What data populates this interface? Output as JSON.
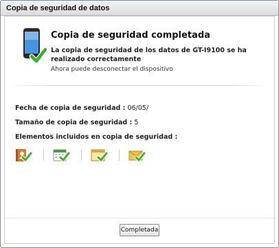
{
  "window": {
    "title": "Copia de seguridad de datos"
  },
  "header": {
    "title": "Copia de seguridad completada",
    "subtitle": "La copia de seguridad de los datos de GT-I9100 se ha realizado correctamente",
    "note": "Ahora puede desconectar el dispositivo"
  },
  "details": {
    "date_label": "Fecha de copia de seguridad :",
    "date_value": "06/05/",
    "size_label": "Tamaño de copia de seguridad :",
    "size_value": "5",
    "items_label": "Elementos incluidos en copia de seguridad :"
  },
  "items": [
    {
      "icon": "contacts-icon"
    },
    {
      "icon": "calendar-icon"
    },
    {
      "icon": "window-icon"
    },
    {
      "icon": "message-icon"
    }
  ],
  "footer": {
    "button_label": "Completada"
  },
  "colors": {
    "check": "#3fae2a",
    "phone": "#3a86d6"
  }
}
